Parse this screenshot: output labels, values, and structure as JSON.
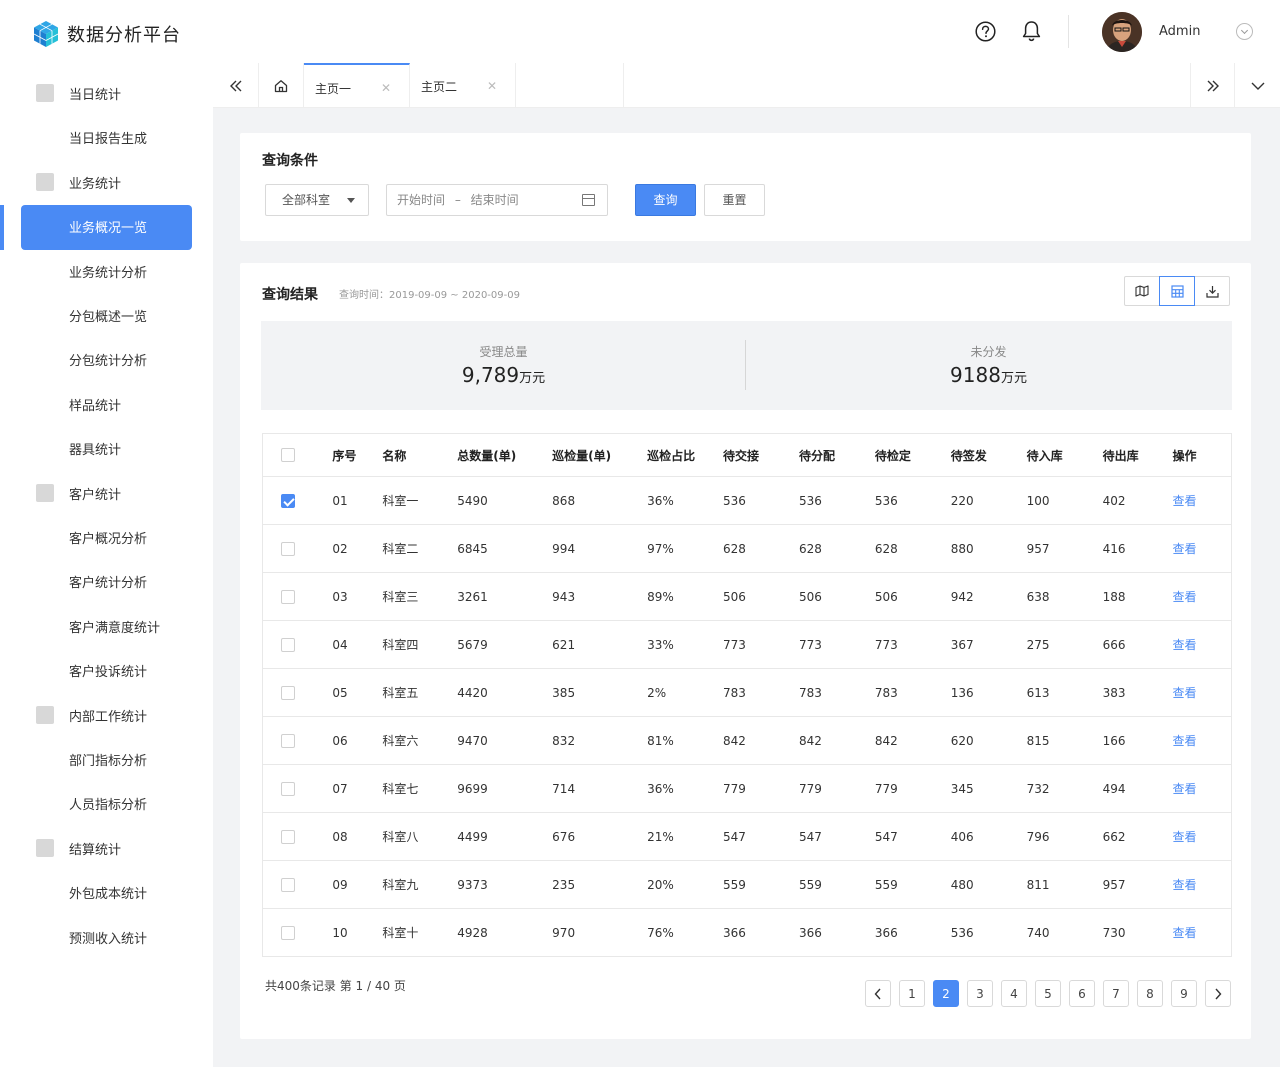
{
  "app": {
    "title": "数据分析平台"
  },
  "header": {
    "user_name": "Admin"
  },
  "sidebar": {
    "items": [
      {
        "label": "当日统计",
        "group": true,
        "icon": "calendar-check-icon"
      },
      {
        "label": "当日报告生成",
        "group": false
      },
      {
        "label": "业务统计",
        "group": true,
        "icon": "bar-chart-icon"
      },
      {
        "label": "业务概况一览",
        "group": false,
        "active": true
      },
      {
        "label": "业务统计分析",
        "group": false
      },
      {
        "label": "分包概述一览",
        "group": false
      },
      {
        "label": "分包统计分析",
        "group": false
      },
      {
        "label": "样品统计",
        "group": false
      },
      {
        "label": "器具统计",
        "group": false
      },
      {
        "label": "客户统计",
        "group": true,
        "icon": "user-card-icon"
      },
      {
        "label": "客户概况分析",
        "group": false
      },
      {
        "label": "客户统计分析",
        "group": false
      },
      {
        "label": "客户满意度统计",
        "group": false
      },
      {
        "label": "客户投诉统计",
        "group": false
      },
      {
        "label": "内部工作统计",
        "group": true,
        "icon": "line-chart-icon"
      },
      {
        "label": "部门指标分析",
        "group": false
      },
      {
        "label": "人员指标分析",
        "group": false
      },
      {
        "label": "结算统计",
        "group": true,
        "icon": "yen-calendar-icon"
      },
      {
        "label": "外包成本统计",
        "group": false
      },
      {
        "label": "预测收入统计",
        "group": false
      }
    ]
  },
  "tabs": [
    {
      "label": "主页一",
      "active": true
    },
    {
      "label": "主页二",
      "active": false
    }
  ],
  "query": {
    "title": "查询条件",
    "dept_select": "全部科室",
    "date_start_placeholder": "开始时间",
    "date_sep": "–",
    "date_end_placeholder": "结束时间",
    "query_button": "查询",
    "reset_button": "重置"
  },
  "result": {
    "title": "查询结果",
    "time_label": "查询时间：2019-09-09 ~ 2020-09-09",
    "stats": [
      {
        "label": "受理总量",
        "value": "9,789",
        "unit": "万元"
      },
      {
        "label": "未分发",
        "value": "9188",
        "unit": "万元"
      }
    ],
    "columns": [
      "序号",
      "名称",
      "总数量(单)",
      "巡检量(单)",
      "巡检占比",
      "待交接",
      "待分配",
      "待检定",
      "待签发",
      "待入库",
      "待出库",
      "操作"
    ],
    "rows": [
      {
        "checked": true,
        "cells": [
          "01",
          "科室一",
          "5490",
          "868",
          "36%",
          "536",
          "536",
          "536",
          "220",
          "100",
          "402"
        ]
      },
      {
        "checked": false,
        "cells": [
          "02",
          "科室二",
          "6845",
          "994",
          "97%",
          "628",
          "628",
          "628",
          "880",
          "957",
          "416"
        ]
      },
      {
        "checked": false,
        "cells": [
          "03",
          "科室三",
          "3261",
          "943",
          "89%",
          "506",
          "506",
          "506",
          "942",
          "638",
          "188"
        ]
      },
      {
        "checked": false,
        "cells": [
          "04",
          "科室四",
          "5679",
          "621",
          "33%",
          "773",
          "773",
          "773",
          "367",
          "275",
          "666"
        ]
      },
      {
        "checked": false,
        "cells": [
          "05",
          "科室五",
          "4420",
          "385",
          "2%",
          "783",
          "783",
          "783",
          "136",
          "613",
          "383"
        ]
      },
      {
        "checked": false,
        "cells": [
          "06",
          "科室六",
          "9470",
          "832",
          "81%",
          "842",
          "842",
          "842",
          "620",
          "815",
          "166"
        ]
      },
      {
        "checked": false,
        "cells": [
          "07",
          "科室七",
          "9699",
          "714",
          "36%",
          "779",
          "779",
          "779",
          "345",
          "732",
          "494"
        ]
      },
      {
        "checked": false,
        "cells": [
          "08",
          "科室八",
          "4499",
          "676",
          "21%",
          "547",
          "547",
          "547",
          "406",
          "796",
          "662"
        ]
      },
      {
        "checked": false,
        "cells": [
          "09",
          "科室九",
          "9373",
          "235",
          "20%",
          "559",
          "559",
          "559",
          "480",
          "811",
          "957"
        ]
      },
      {
        "checked": false,
        "cells": [
          "10",
          "科室十",
          "4928",
          "970",
          "76%",
          "366",
          "366",
          "366",
          "536",
          "740",
          "730"
        ]
      }
    ],
    "action_label": "查看",
    "footer_text": "共400条记录   第 1 / 40 页",
    "pages": [
      "1",
      "2",
      "3",
      "4",
      "5",
      "6",
      "7",
      "8",
      "9"
    ],
    "current_page": "2"
  },
  "colors": {
    "accent": "#4a8af4",
    "bg": "#f2f3f5"
  }
}
